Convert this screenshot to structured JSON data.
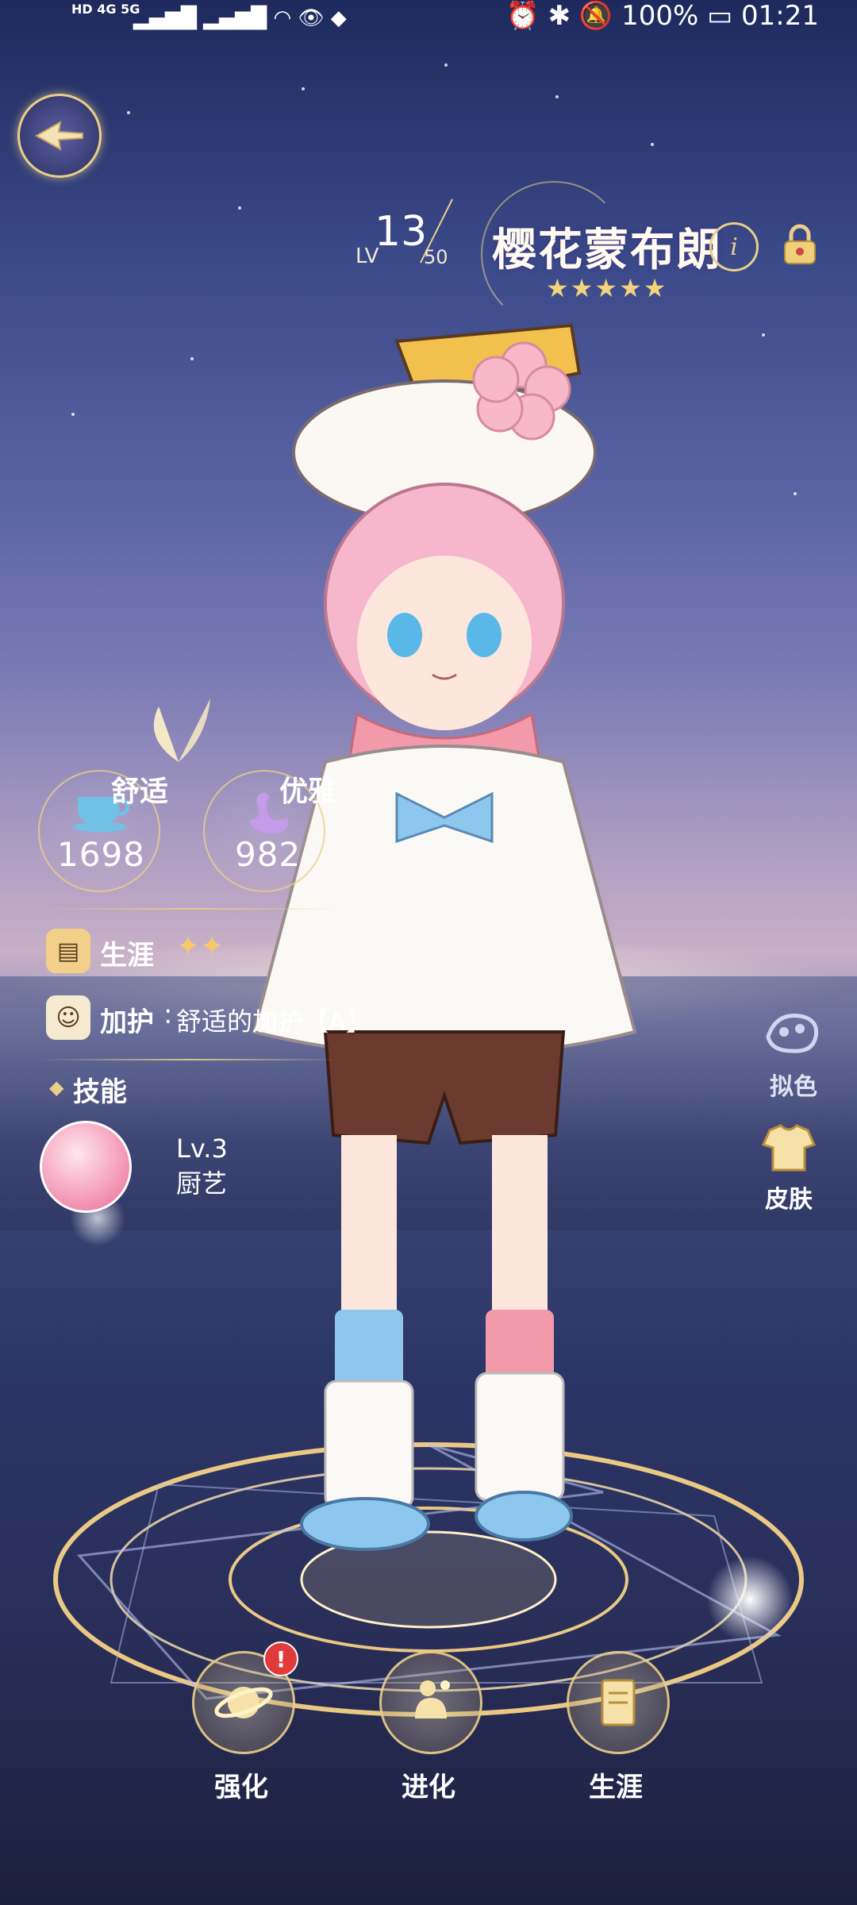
{
  "status_bar": {
    "network_left": "HD 4G 5G",
    "battery": "100%",
    "time": "01:21"
  },
  "character": {
    "level_prefix": "LV",
    "level": "13",
    "level_max": "50",
    "name": "樱花蒙布朗",
    "rarity_stars": "★★★★★",
    "edit_glyph": "i"
  },
  "stats": [
    {
      "label": "舒适",
      "value": "1698",
      "icon": "teacup-icon"
    },
    {
      "label": "优雅",
      "value": "982",
      "icon": "swan-icon"
    }
  ],
  "career": {
    "label": "生涯",
    "stars": "✦✦"
  },
  "protection": {
    "label": "加护",
    "value": "舒适的加护【A】"
  },
  "skill_section": {
    "label": "技能"
  },
  "skill": {
    "level": "Lv.3",
    "name": "厨艺",
    "icon": "cooking-pot-icon"
  },
  "side_buttons": {
    "dye": "拟色",
    "skin": "皮肤"
  },
  "bottom_buttons": [
    {
      "label": "强化",
      "icon": "planet-icon",
      "badge": "!"
    },
    {
      "label": "进化",
      "icon": "evolve-icon"
    },
    {
      "label": "生涯",
      "icon": "career-book-icon"
    }
  ],
  "colors": {
    "accent_gold": "#e9cf8a",
    "badge_red": "#e23a3a",
    "star_gold": "#f2d27a"
  }
}
